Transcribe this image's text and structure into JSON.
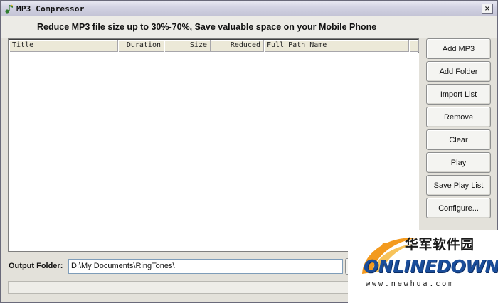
{
  "window": {
    "title": "MP3 Compressor",
    "close_label": "×"
  },
  "header": {
    "tagline": "Reduce MP3 file size up to 30%-70%, Save valuable space on your Mobile Phone"
  },
  "file_list": {
    "columns": [
      "Title",
      "Duration",
      "Size",
      "Reduced",
      "Full Path Name"
    ],
    "rows": []
  },
  "buttons": {
    "add_mp3": "Add MP3",
    "add_folder": "Add Folder",
    "import_list": "Import List",
    "remove": "Remove",
    "clear": "Clear",
    "play": "Play",
    "save_play_list": "Save Play List",
    "configure": "Configure..."
  },
  "output": {
    "label": "Output Folder:",
    "value": "D:\\My Documents\\RingTones\\"
  },
  "watermark": {
    "chinese": "华军软件园",
    "logo": "ONLINEDOWN",
    "url": "www.newhua.com"
  },
  "colors": {
    "logo_blue": "#1a4d9a",
    "logo_orange": "#f39a1e"
  }
}
